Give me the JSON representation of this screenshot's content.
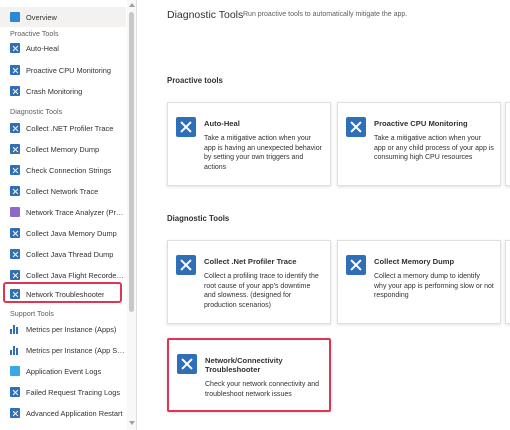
{
  "sidebar": {
    "overview": "Overview",
    "headers": {
      "proactive": "Proactive Tools",
      "diagnostic": "Diagnostic Tools",
      "support": "Support Tools"
    },
    "proactive_items": [
      "Auto-Heal",
      "Proactive CPU Monitoring",
      "Crash Monitoring"
    ],
    "diagnostic_items": [
      "Collect .NET Profiler Trace",
      "Collect Memory Dump",
      "Check Connection Strings",
      "Collect Network Trace",
      "Network Trace Analyzer (Previ...",
      "Collect Java Memory Dump",
      "Collect Java Thread Dump",
      "Collect Java Flight Recorder T...",
      "Network Troubleshooter"
    ],
    "support_items": [
      "Metrics per Instance (Apps)",
      "Metrics per Instance (App Ser...",
      "Application Event Logs",
      "Failed Request Tracing Logs",
      "Advanced Application Restart"
    ]
  },
  "main": {
    "title": "Diagnostic Tools",
    "subtitle": "Run proactive tools to automatically mitigate the app.",
    "sections": {
      "proactive": "Proactive tools",
      "diagnostic": "Diagnostic Tools"
    },
    "cards": {
      "auto_heal": {
        "title": "Auto-Heal",
        "desc": "Take a mitigative action when your app is having an unexpected behavior by setting your own triggers and actions"
      },
      "cpu": {
        "title": "Proactive CPU Monitoring",
        "desc": "Take a mitigative action when your app or any child process of your app is consuming high CPU resources"
      },
      "profiler": {
        "title": "Collect .Net Profiler Trace",
        "desc": "Collect a profiling trace to identify the root cause of your app's downtime and slowness. (designed for production scenarios)"
      },
      "memdump": {
        "title": "Collect Memory Dump",
        "desc": "Collect a memory dump to identify why your app is performing slow or not responding"
      },
      "network": {
        "title": "Network/Connectivity Troubleshooter",
        "desc": "Check your network connectivity and troubleshoot network issues"
      }
    }
  },
  "colors": {
    "accent": "#2f6fb8",
    "highlight": "#e03356"
  }
}
